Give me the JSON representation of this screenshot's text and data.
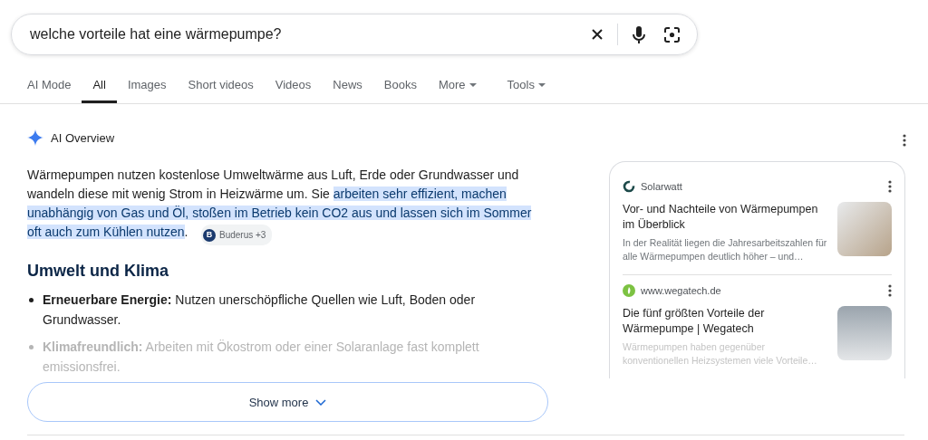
{
  "search": {
    "value": "welche vorteile hat eine wärmepumpe?"
  },
  "tabs": [
    {
      "label": "AI Mode",
      "selected": false,
      "dropdown": false
    },
    {
      "label": "All",
      "selected": true,
      "dropdown": false
    },
    {
      "label": "Images",
      "selected": false,
      "dropdown": false
    },
    {
      "label": "Short videos",
      "selected": false,
      "dropdown": false
    },
    {
      "label": "Videos",
      "selected": false,
      "dropdown": false
    },
    {
      "label": "News",
      "selected": false,
      "dropdown": false
    },
    {
      "label": "Books",
      "selected": false,
      "dropdown": false
    },
    {
      "label": "More",
      "selected": false,
      "dropdown": true
    },
    {
      "label": "Tools",
      "selected": false,
      "dropdown": true
    }
  ],
  "overview": {
    "title": "AI Overview",
    "paragraph": [
      {
        "text": "Wärmepumpen nutzen kostenlose Umweltwärme aus Luft, Erde oder Grundwasser und wandeln diese mit wenig Strom in Heizwärme um. Sie ",
        "highlighted": false
      },
      {
        "text": "arbeiten sehr effizient, machen unabhängig von Gas und Öl, stoßen im Betrieb kein CO2 aus und lassen sich im Sommer oft auch zum Kühlen nutzen",
        "highlighted": true
      },
      {
        "text": ".",
        "highlighted": false
      }
    ],
    "citation": {
      "letter": "B",
      "label": "Buderus +3"
    },
    "heading": "Umwelt und Klima",
    "bullets": [
      {
        "text": "**Erneuerbare Energie:** Nutzen unerschöpfliche Quellen wie Luft, Boden oder Grundwasser.",
        "faded": false
      },
      {
        "text": "**Klimafreundlich:** Arbeiten mit Ökostrom oder einer Solaranlage fast komplett emissionsfrei.",
        "faded": true
      }
    ],
    "show_more": "Show more"
  },
  "sources": [
    {
      "site": "Solarwatt",
      "kind": "ring",
      "title": "Vor- und Nachteile von Wärmepumpen im Überblick",
      "snippet": "In der Realität liegen die Jahresarbeitszahlen für alle Wärmepumpen deutlich höher – und…",
      "faded": false
    },
    {
      "site": "www.wegatech.de",
      "kind": "leaf",
      "title": "Die fünf größten Vorteile der Wärmepumpe | Wegatech",
      "snippet": "Wärmepumpen haben gegenüber konventionellen Heizsystemen viele Vorteile…",
      "faded": true
    }
  ]
}
